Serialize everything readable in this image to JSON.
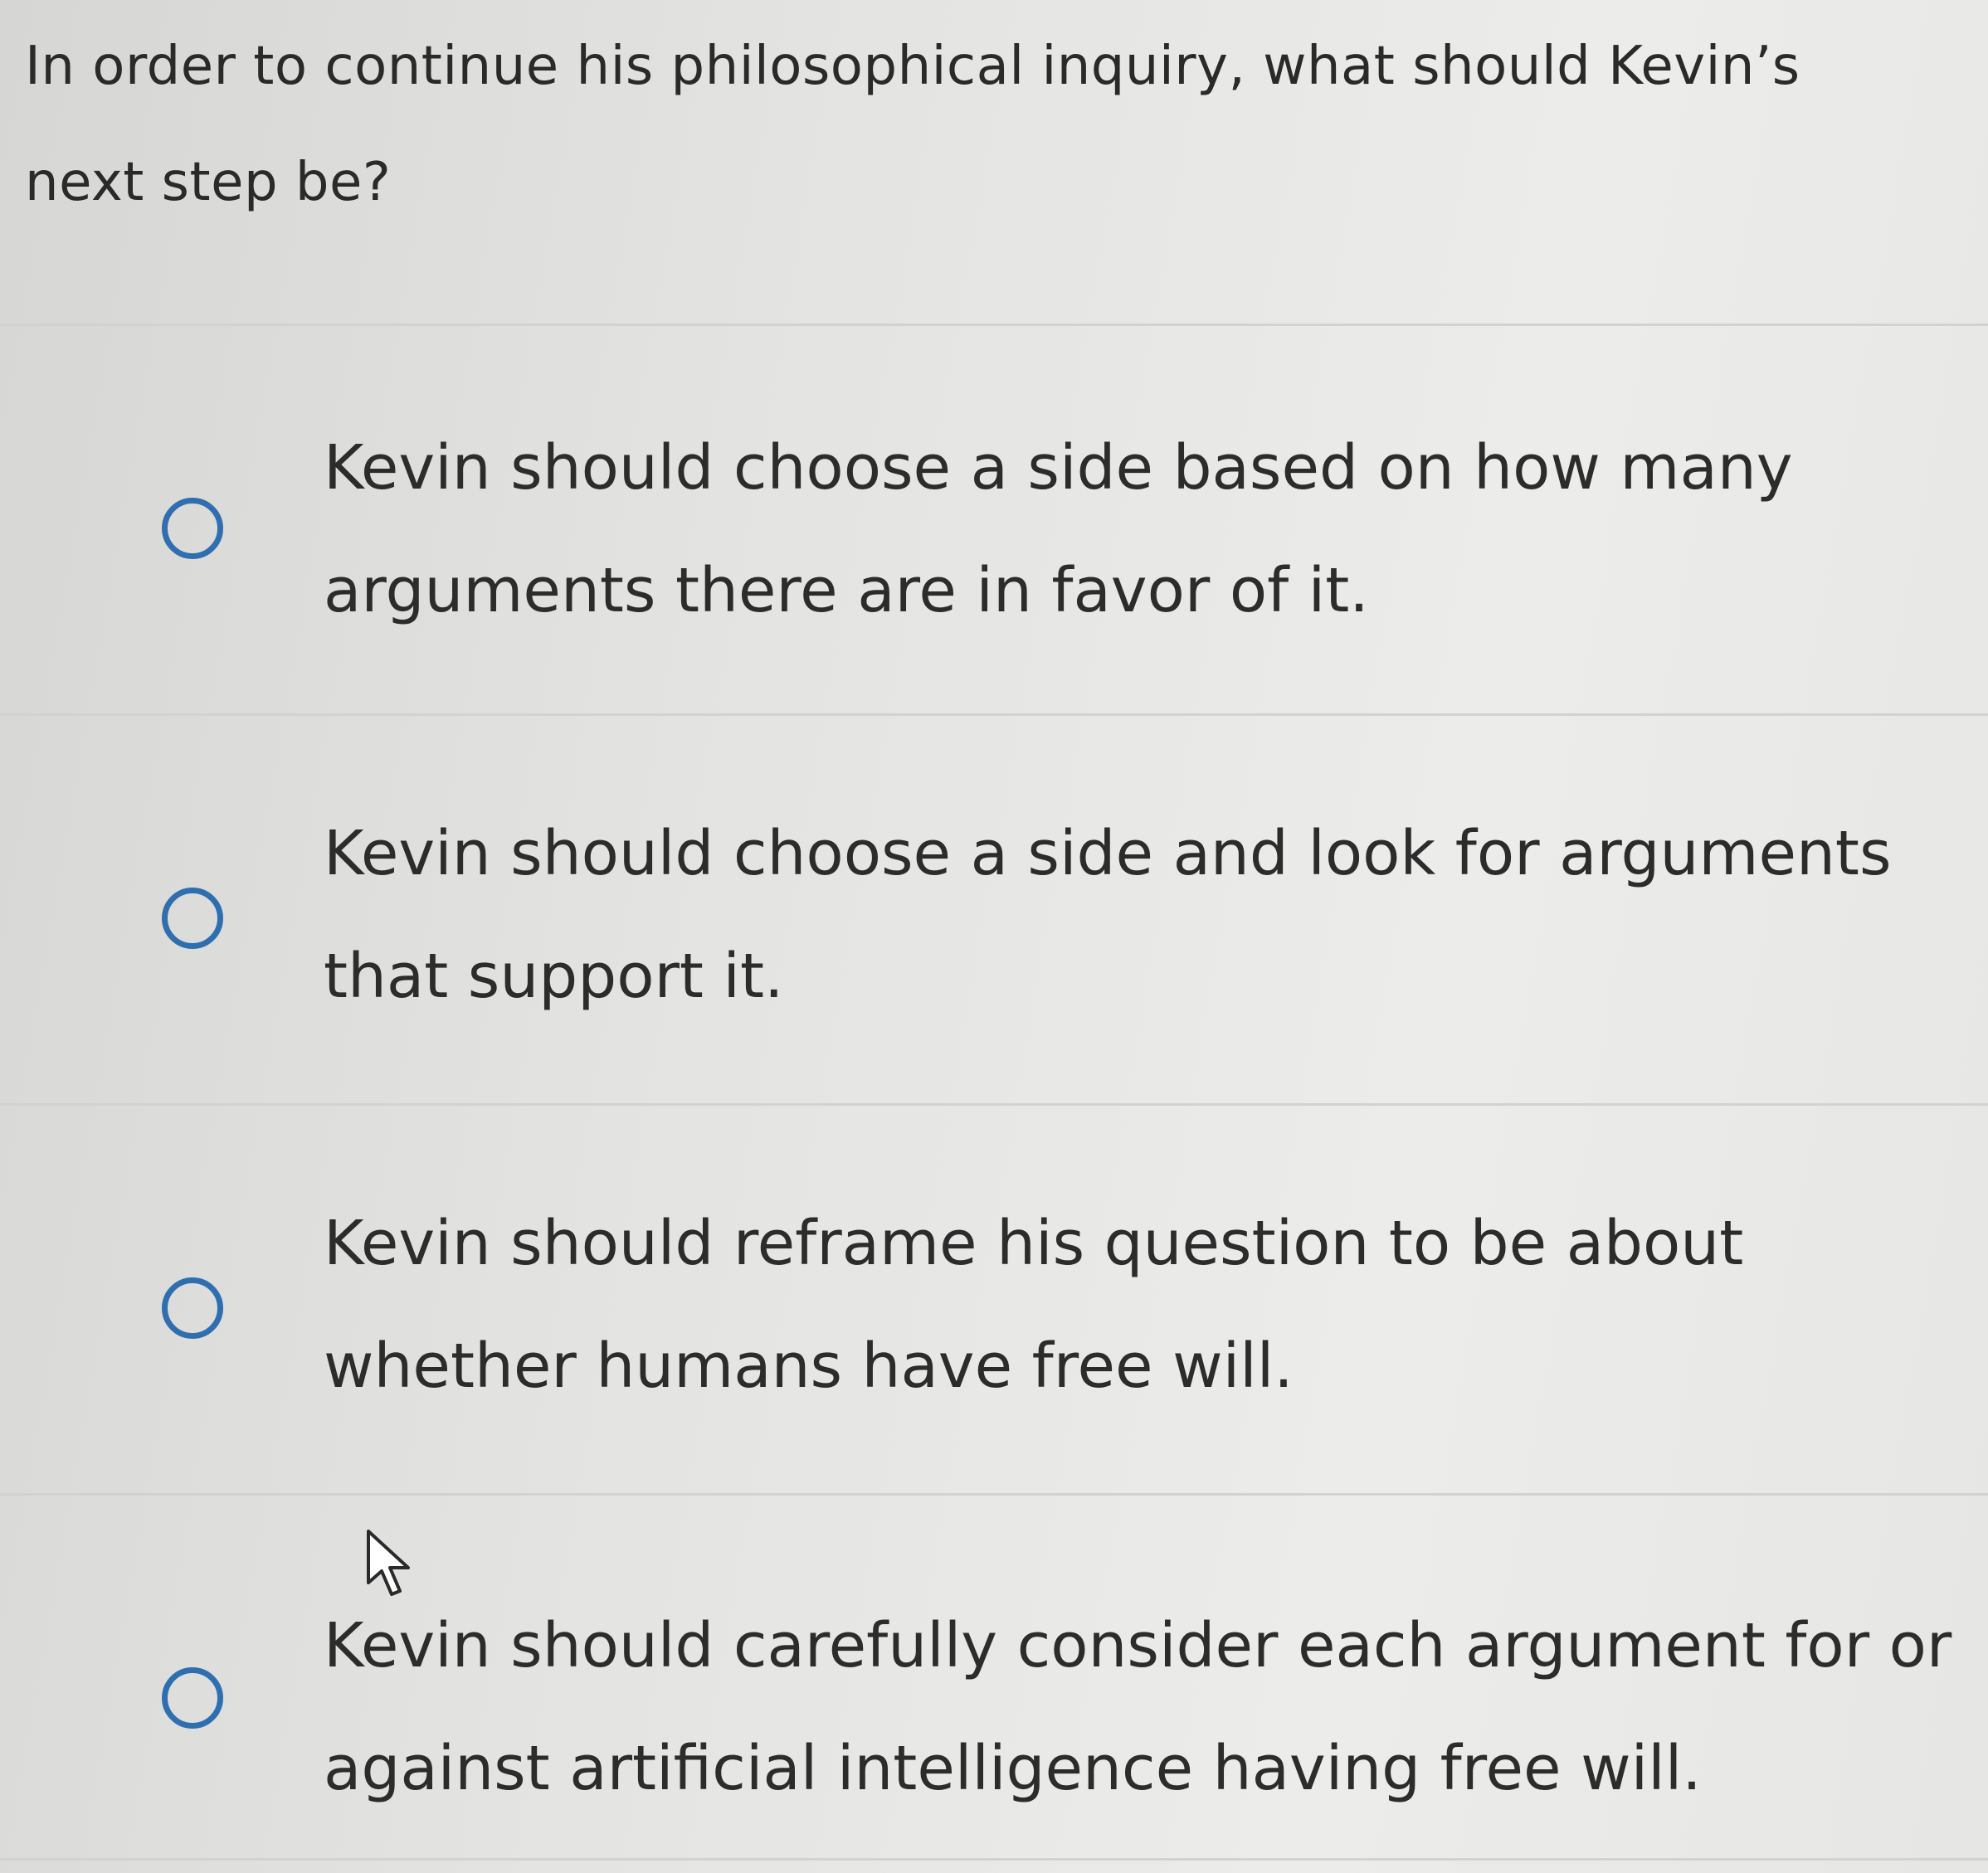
{
  "question": {
    "text": "In order to continue his philosophical inquiry, what should Kevin’s next step be?"
  },
  "options": [
    {
      "label": "Kevin should choose a side based on how many arguments there are in favor of it."
    },
    {
      "label": "Kevin should choose a side and look for arguments that support it."
    },
    {
      "label": "Kevin should reframe his question to be about whether humans have free will."
    },
    {
      "label": "Kevin should carefully consider each argument for or against artificial intelligence having free will."
    }
  ],
  "colors": {
    "radio_border": "#2f6fb0",
    "text": "#2c2c2c",
    "divider": "#d2d2d0"
  },
  "icons": {
    "radio": "radio-button-icon",
    "cursor": "mouse-pointer-icon"
  }
}
